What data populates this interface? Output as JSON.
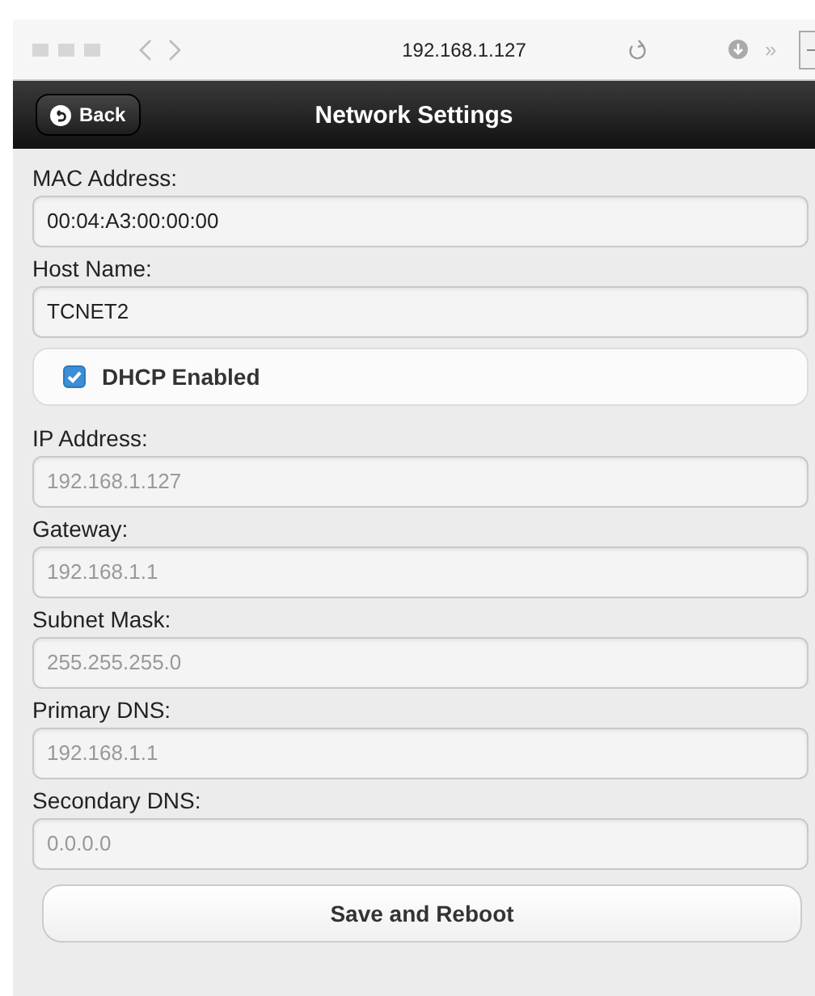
{
  "browser": {
    "url": "192.168.1.127",
    "overflow": "»"
  },
  "header": {
    "back": "Back",
    "title": "Network Settings"
  },
  "fields": [
    {
      "kind": "text",
      "label": "MAC Address:",
      "value": "00:04:A3:00:00:00",
      "disabled": false
    },
    {
      "kind": "text",
      "label": "Host Name:",
      "value": "TCNET2",
      "disabled": false
    },
    {
      "kind": "checkbox",
      "label": "DHCP Enabled",
      "checked": true
    },
    {
      "kind": "text",
      "label": "IP Address:",
      "value": "192.168.1.127",
      "disabled": true
    },
    {
      "kind": "text",
      "label": "Gateway:",
      "value": "192.168.1.1",
      "disabled": true
    },
    {
      "kind": "text",
      "label": "Subnet Mask:",
      "value": "255.255.255.0",
      "disabled": true
    },
    {
      "kind": "text",
      "label": "Primary DNS:",
      "value": "192.168.1.1",
      "disabled": true
    },
    {
      "kind": "text",
      "label": "Secondary DNS:",
      "value": "0.0.0.0",
      "disabled": true
    }
  ],
  "save": "Save and Reboot"
}
